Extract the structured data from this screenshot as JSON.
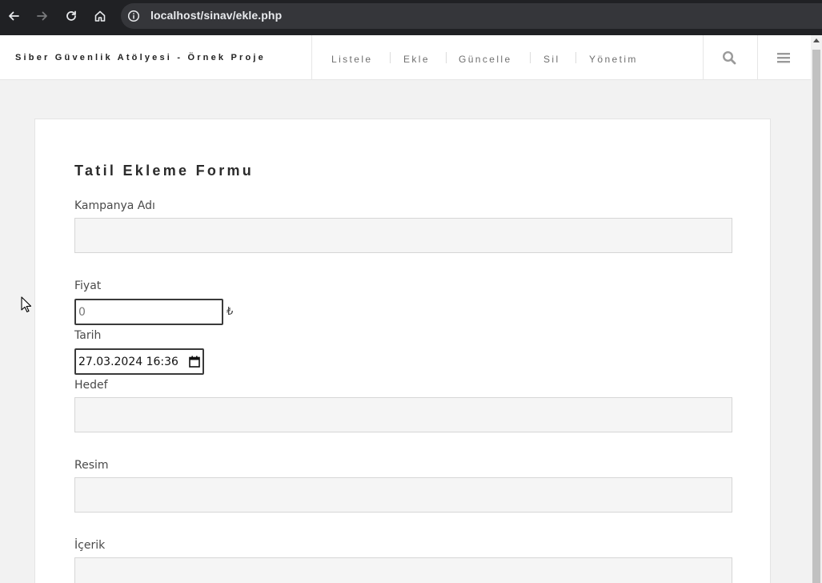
{
  "browser": {
    "url": "localhost/sinav/ekle.php",
    "icons": [
      "back-arrow-icon",
      "forward-arrow-icon",
      "reload-icon",
      "home-icon",
      "info-icon"
    ]
  },
  "site": {
    "brand": "Siber Güvenlik Atölyesi - Örnek Proje",
    "menu": [
      "Listele",
      "Ekle",
      "Güncelle",
      "Sil",
      "Yönetim"
    ],
    "icons": [
      "search-icon",
      "hamburger-menu-icon"
    ]
  },
  "form": {
    "title": "Tatil Ekleme Formu",
    "campaign_label": "Kampanya Adı",
    "campaign_value": "",
    "price_label": "Fiyat",
    "price_value": "0",
    "currency_symbol": "₺",
    "date_label": "Tarih",
    "date_value": "27.03.2024 16:36",
    "target_label": "Hedef",
    "target_value": "",
    "image_label": "Resim",
    "image_value": "",
    "content_label": "İçerik",
    "content_value": ""
  },
  "colors": {
    "chrome_bg": "#202124",
    "address_bg": "#35363a",
    "page_bg": "#f2f2f2",
    "input_bg": "#f5f5f5"
  }
}
